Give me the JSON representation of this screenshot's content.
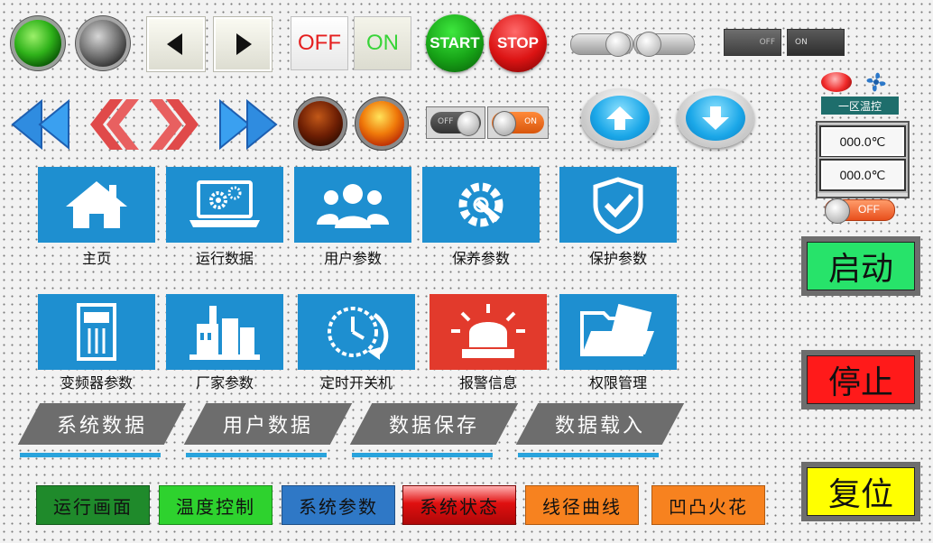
{
  "offon": {
    "off": "OFF",
    "on": "ON"
  },
  "round_buttons": {
    "start": "START",
    "stop": "STOP"
  },
  "toggle_small": {
    "off": "OFF",
    "on": "ON"
  },
  "toggle_small2": {
    "off": "OFF",
    "on": "ON"
  },
  "slider_switch": {
    "off": "OFF"
  },
  "zone": {
    "title": "一区温控",
    "temp1": "000.0℃",
    "temp2": "000.0℃"
  },
  "tiles_row1": [
    {
      "label": "主页",
      "icon": "home-icon"
    },
    {
      "label": "运行数据",
      "icon": "laptop-gears-icon"
    },
    {
      "label": "用户参数",
      "icon": "users-icon"
    },
    {
      "label": "保养参数",
      "icon": "gear-wrench-icon"
    },
    {
      "label": "保护参数",
      "icon": "shield-check-icon"
    }
  ],
  "tiles_row2": [
    {
      "label": "变频器参数",
      "icon": "inverter-icon"
    },
    {
      "label": "厂家参数",
      "icon": "factory-icon"
    },
    {
      "label": "定时开关机",
      "icon": "timer-clock-icon"
    },
    {
      "label": "报警信息",
      "icon": "alarm-light-icon"
    },
    {
      "label": "权限管理",
      "icon": "folder-doc-icon"
    }
  ],
  "nav_tabs": [
    "系统数据",
    "用户数据",
    "数据保存",
    "数据载入"
  ],
  "bottom_buttons": [
    "运行画面",
    "温度控制",
    "系统参数",
    "系统状态",
    "线径曲线",
    "凹凸火花"
  ],
  "big_buttons": {
    "start": "启动",
    "stop": "停止",
    "reset": "复位"
  },
  "colors": {
    "tile_blue": "#1e8fd0",
    "tile_red": "#e23a2c",
    "accent_line": "#29a3dc",
    "btn_dark_green": "#1f8a2b",
    "btn_green": "#2ed22e",
    "btn_blue": "#2f78c6",
    "btn_red": "#e01010",
    "btn_orange": "#f7821f",
    "big_start": "#27e36a",
    "big_stop": "#ff1a1a",
    "big_reset": "#ffff00"
  }
}
